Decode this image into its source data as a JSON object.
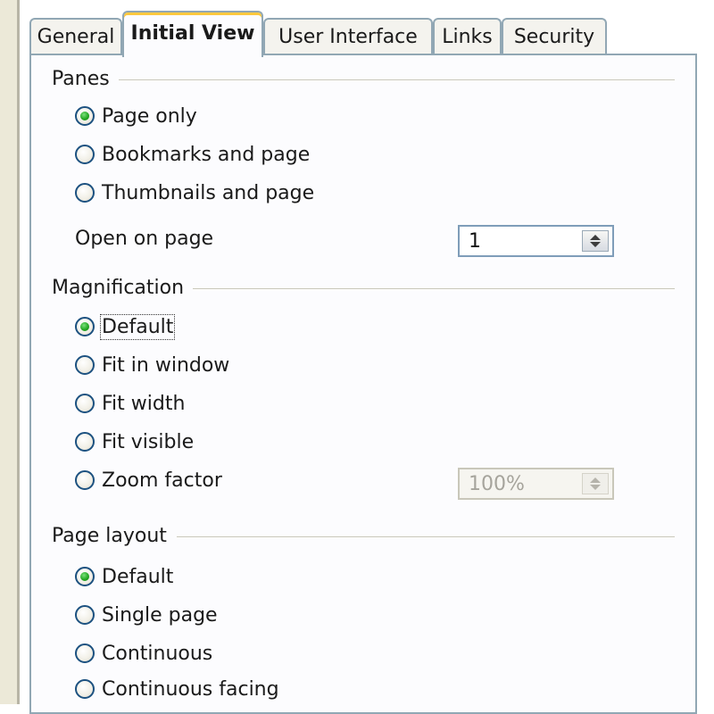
{
  "tabs": [
    {
      "label": "General",
      "active": false
    },
    {
      "label": "Initial View",
      "active": true
    },
    {
      "label": "User Interface",
      "active": false
    },
    {
      "label": "Links",
      "active": false
    },
    {
      "label": "Security",
      "active": false
    }
  ],
  "panes": {
    "title": "Panes",
    "options": [
      {
        "label": "Page only",
        "checked": true
      },
      {
        "label": "Bookmarks and page",
        "checked": false
      },
      {
        "label": "Thumbnails and page",
        "checked": false
      }
    ],
    "open_on_page_label": "Open on page",
    "open_on_page_value": "1"
  },
  "magnification": {
    "title": "Magnification",
    "options": [
      {
        "label": "Default",
        "checked": true
      },
      {
        "label": "Fit in window",
        "checked": false
      },
      {
        "label": "Fit width",
        "checked": false
      },
      {
        "label": "Fit visible",
        "checked": false
      },
      {
        "label": "Zoom factor",
        "checked": false
      }
    ],
    "zoom_value": "100%"
  },
  "page_layout": {
    "title": "Page layout",
    "options": [
      {
        "label": "Default",
        "checked": true
      },
      {
        "label": "Single page",
        "checked": false
      },
      {
        "label": "Continuous",
        "checked": false
      },
      {
        "label": "Continuous facing",
        "checked": false
      }
    ]
  },
  "colors": {
    "active_tab_accent": "#ffc83d",
    "radio_checked": "#24a824",
    "tab_border": "#91a7b4"
  }
}
